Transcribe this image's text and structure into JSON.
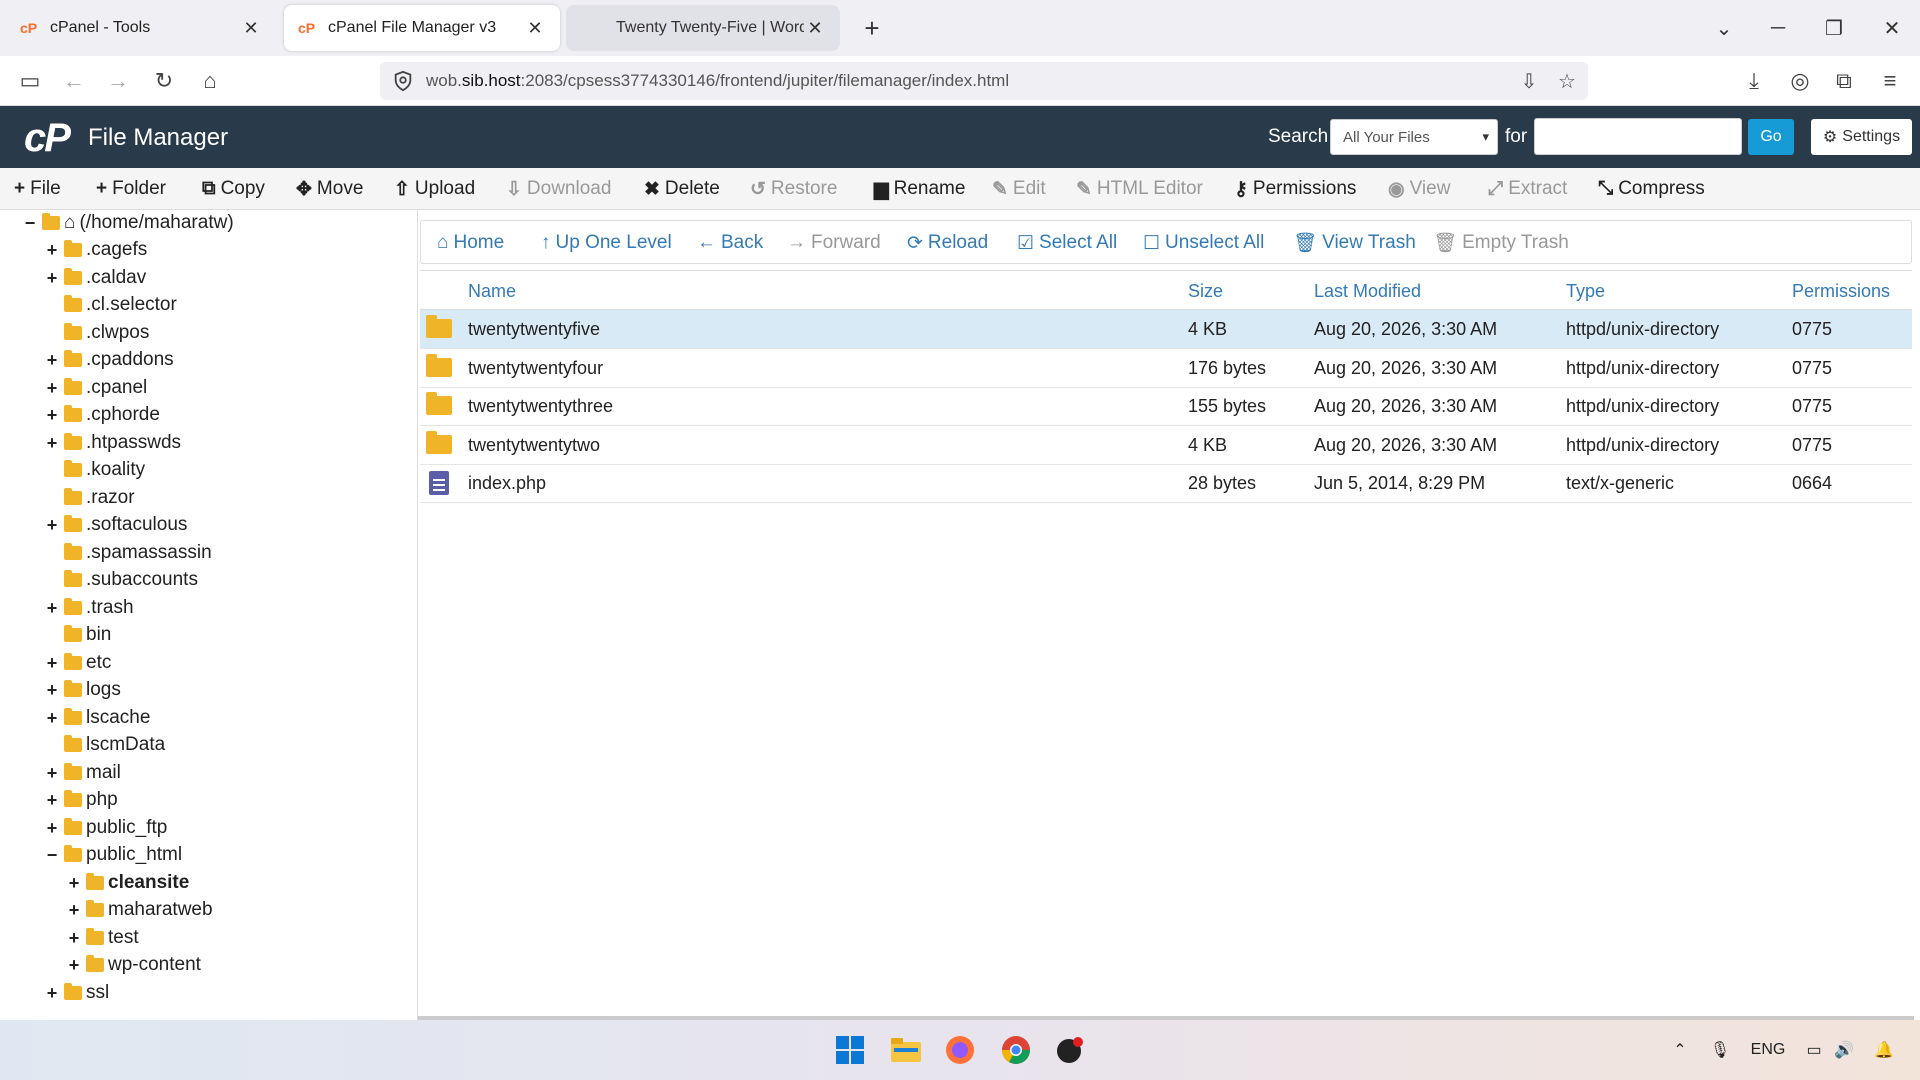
{
  "browser": {
    "tabs": [
      {
        "title": "cPanel - Tools"
      },
      {
        "title": "cPanel File Manager v3"
      },
      {
        "title": "Twenty Twenty-Five | WordPress"
      }
    ],
    "new_tab": "+",
    "url_prefix": "wob.",
    "url_host": "sib.host",
    "url_rest": ":2083/cpsess3774330146/frontend/jupiter/filemanager/index.html"
  },
  "header": {
    "logo": "cP",
    "title": "File Manager",
    "search_label": "Search",
    "search_scope": "All Your Files",
    "for_label": "for",
    "go_label": "Go",
    "settings_label": "Settings"
  },
  "toolbar": [
    {
      "icon": "+",
      "label": "File",
      "enabled": true
    },
    {
      "icon": "+",
      "label": "Folder",
      "enabled": true
    },
    {
      "icon": "⧉",
      "label": "Copy",
      "enabled": true
    },
    {
      "icon": "✥",
      "label": "Move",
      "enabled": true
    },
    {
      "icon": "⇧",
      "label": "Upload",
      "enabled": true
    },
    {
      "icon": "⇩",
      "label": "Download",
      "enabled": false
    },
    {
      "icon": "✖",
      "label": "Delete",
      "enabled": true
    },
    {
      "icon": "↺",
      "label": "Restore",
      "enabled": false
    },
    {
      "icon": "▆",
      "label": "Rename",
      "enabled": true
    },
    {
      "icon": "✎",
      "label": "Edit",
      "enabled": false
    },
    {
      "icon": "✎",
      "label": "HTML Editor",
      "enabled": false
    },
    {
      "icon": "⚷",
      "label": "Permissions",
      "enabled": true
    },
    {
      "icon": "◉",
      "label": "View",
      "enabled": false
    },
    {
      "icon": "⤢",
      "label": "Extract",
      "enabled": false
    },
    {
      "icon": "⤡",
      "label": "Compress",
      "enabled": true
    }
  ],
  "tree": {
    "root": "(/home/maharatw)",
    "nodes": [
      {
        "label": ".cagefs",
        "exp": "+",
        "level": 1
      },
      {
        "label": ".caldav",
        "exp": "+",
        "level": 1
      },
      {
        "label": ".cl.selector",
        "exp": "",
        "level": 1
      },
      {
        "label": ".clwpos",
        "exp": "",
        "level": 1
      },
      {
        "label": ".cpaddons",
        "exp": "+",
        "level": 1
      },
      {
        "label": ".cpanel",
        "exp": "+",
        "level": 1
      },
      {
        "label": ".cphorde",
        "exp": "+",
        "level": 1
      },
      {
        "label": ".htpasswds",
        "exp": "+",
        "level": 1
      },
      {
        "label": ".koality",
        "exp": "",
        "level": 1
      },
      {
        "label": ".razor",
        "exp": "",
        "level": 1
      },
      {
        "label": ".softaculous",
        "exp": "+",
        "level": 1
      },
      {
        "label": ".spamassassin",
        "exp": "",
        "level": 1
      },
      {
        "label": ".subaccounts",
        "exp": "",
        "level": 1
      },
      {
        "label": ".trash",
        "exp": "+",
        "level": 1
      },
      {
        "label": "bin",
        "exp": "",
        "level": 1
      },
      {
        "label": "etc",
        "exp": "+",
        "level": 1
      },
      {
        "label": "logs",
        "exp": "+",
        "level": 1
      },
      {
        "label": "lscache",
        "exp": "+",
        "level": 1
      },
      {
        "label": "lscmData",
        "exp": "",
        "level": 1
      },
      {
        "label": "mail",
        "exp": "+",
        "level": 1
      },
      {
        "label": "php",
        "exp": "+",
        "level": 1
      },
      {
        "label": "public_ftp",
        "exp": "+",
        "level": 1
      },
      {
        "label": "public_html",
        "exp": "−",
        "level": 1
      },
      {
        "label": "cleansite",
        "exp": "+",
        "level": 2,
        "bold": true
      },
      {
        "label": "maharatweb",
        "exp": "+",
        "level": 2
      },
      {
        "label": "test",
        "exp": "+",
        "level": 2
      },
      {
        "label": "wp-content",
        "exp": "+",
        "level": 2
      },
      {
        "label": "ssl",
        "exp": "+",
        "level": 1
      }
    ]
  },
  "subtoolbar": [
    {
      "icon": "⌂",
      "label": "Home",
      "enabled": true
    },
    {
      "icon": "↑",
      "label": "Up One Level",
      "enabled": true
    },
    {
      "icon": "←",
      "label": "Back",
      "enabled": true
    },
    {
      "icon": "→",
      "label": "Forward",
      "enabled": false
    },
    {
      "icon": "⟳",
      "label": "Reload",
      "enabled": true
    },
    {
      "icon": "☑",
      "label": "Select All",
      "enabled": true
    },
    {
      "icon": "☐",
      "label": "Unselect All",
      "enabled": true
    },
    {
      "icon": "🗑",
      "label": "View Trash",
      "enabled": true
    },
    {
      "icon": "🗑",
      "label": "Empty Trash",
      "enabled": false
    }
  ],
  "table": {
    "columns": [
      "Name",
      "Size",
      "Last Modified",
      "Type",
      "Permissions"
    ],
    "rows": [
      {
        "icon": "folder",
        "name": "twentytwentyfive",
        "size": "4 KB",
        "modified": "Aug 20, 2026, 3:30 AM",
        "type": "httpd/unix-directory",
        "perms": "0775",
        "selected": true
      },
      {
        "icon": "folder",
        "name": "twentytwentyfour",
        "size": "176 bytes",
        "modified": "Aug 20, 2026, 3:30 AM",
        "type": "httpd/unix-directory",
        "perms": "0775",
        "selected": false
      },
      {
        "icon": "folder",
        "name": "twentytwentythree",
        "size": "155 bytes",
        "modified": "Aug 20, 2026, 3:30 AM",
        "type": "httpd/unix-directory",
        "perms": "0775",
        "selected": false
      },
      {
        "icon": "folder",
        "name": "twentytwentytwo",
        "size": "4 KB",
        "modified": "Aug 20, 2026, 3:30 AM",
        "type": "httpd/unix-directory",
        "perms": "0775",
        "selected": false
      },
      {
        "icon": "file",
        "name": "index.php",
        "size": "28 bytes",
        "modified": "Jun 5, 2014, 8:29 PM",
        "type": "text/x-generic",
        "perms": "0664",
        "selected": false
      }
    ]
  },
  "taskbar": {
    "lang": "ENG"
  },
  "colors": {
    "header_bg": "#293a4a",
    "accent": "#179bd7",
    "link": "#337ab7",
    "folder": "#f0b429",
    "selected_row": "#d9eaf7"
  }
}
